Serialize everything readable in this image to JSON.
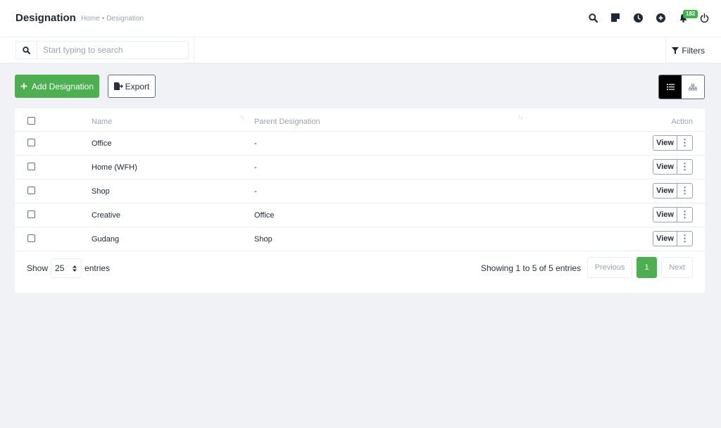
{
  "header": {
    "title": "Designation",
    "breadcrumb": {
      "home": "Home",
      "separator": "•",
      "current": "Designation"
    },
    "icons": [
      "search-icon",
      "sticky-note-icon",
      "clock-icon",
      "plus-circle-icon",
      "bell-icon",
      "power-icon"
    ],
    "notification_count": "182",
    "badge_color": "#39b54a"
  },
  "search": {
    "placeholder": "Start typing to search",
    "value": ""
  },
  "filters": {
    "label": "Filters"
  },
  "toolbar": {
    "add_label": "Add Designation",
    "export_label": "Export",
    "accent_color": "#4caf50"
  },
  "table": {
    "columns": {
      "name": "Name",
      "parent": "Parent Designation",
      "action": "Action"
    },
    "rows": [
      {
        "name": "Office",
        "parent": "-",
        "action": "View"
      },
      {
        "name": "Home (WFH)",
        "parent": "-",
        "action": "View"
      },
      {
        "name": "Shop",
        "parent": "-",
        "action": "View"
      },
      {
        "name": "Creative",
        "parent": "Office",
        "action": "View"
      },
      {
        "name": "Gudang",
        "parent": "Shop",
        "action": "View"
      }
    ]
  },
  "footer": {
    "show_label": "Show",
    "entries_value": "25",
    "entries_label": "entries",
    "info": "Showing 1 to 5 of 5 entries",
    "previous": "Previous",
    "current_page": "1",
    "next": "Next"
  }
}
